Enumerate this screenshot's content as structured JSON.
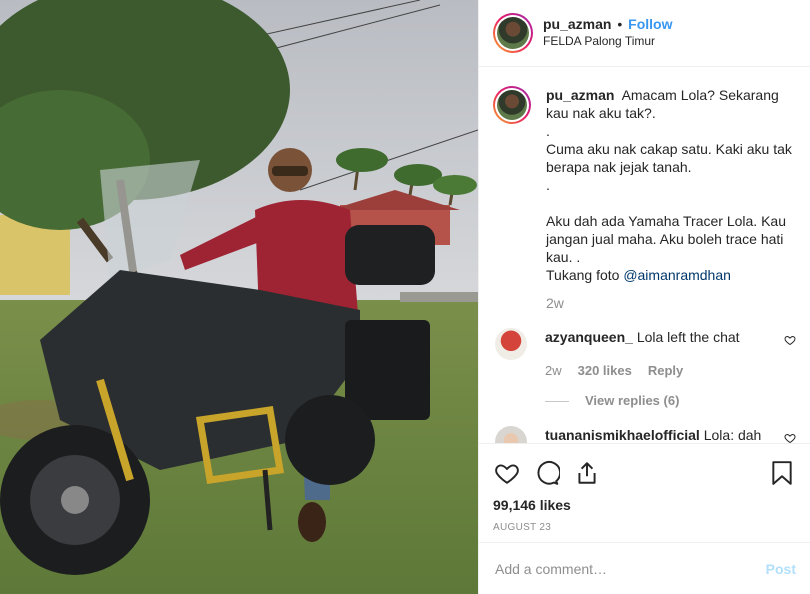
{
  "header": {
    "username": "pu_azman",
    "separator": "•",
    "follow_label": "Follow",
    "location": "FELDA Palong Timur"
  },
  "caption": {
    "username": "pu_azman",
    "lines": [
      "Amacam Lola? Sekarang kau nak aku tak?.",
      ".",
      "Cuma aku nak cakap satu. Kaki aku tak berapa nak jejak tanah.",
      ".",
      "",
      "Aku dah ada Yamaha Tracer Lola. Kau jangan jual maha. Aku boleh trace hati kau. .",
      "Tukang foto"
    ],
    "mention": "@aimanramdhan",
    "time": "2w"
  },
  "comments": [
    {
      "username": "azyanqueen_",
      "text": "Lola left the chat",
      "time": "2w",
      "likes": "320 likes",
      "reply_label": "Reply",
      "view_replies": "View replies (6)"
    },
    {
      "username": "tuananismikhaelofficial",
      "text": "Lola: dah"
    }
  ],
  "actions": {
    "likes": "99,146 likes",
    "date": "AUGUST 23"
  },
  "add_comment": {
    "placeholder": "Add a comment…",
    "post_label": "Post"
  },
  "colors": {
    "link": "#3897f0",
    "muted": "#8e8e8e",
    "post_disabled": "#b2dffc"
  },
  "icons": [
    "heart-icon",
    "comment-icon",
    "share-icon",
    "bookmark-icon"
  ]
}
